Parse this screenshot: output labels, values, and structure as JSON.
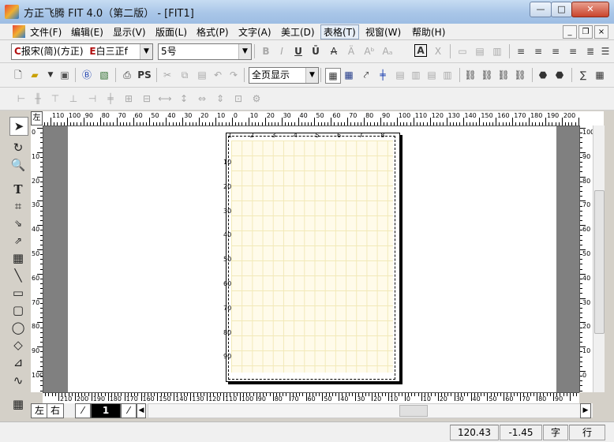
{
  "window": {
    "title": "方正飞腾 FIT 4.0（第二版） - [FIT1]",
    "min": "—",
    "max": "□",
    "close": "✕"
  },
  "menu": [
    {
      "label": "文件(F)"
    },
    {
      "label": "编辑(E)"
    },
    {
      "label": "显示(V)"
    },
    {
      "label": "版面(L)"
    },
    {
      "label": "格式(P)"
    },
    {
      "label": "文字(A)"
    },
    {
      "label": "美工(D)"
    },
    {
      "label": "表格(T)"
    },
    {
      "label": "视窗(W)"
    },
    {
      "label": "帮助(H)"
    }
  ],
  "mdi": {
    "min": "_",
    "restore": "❐",
    "close": "×"
  },
  "format_toolbar": {
    "cn_font_prefix": "C",
    "cn_font": "报宋(简)(方正)",
    "en_font_prefix": "E",
    "en_font": "白三正f",
    "size": "5号",
    "style_buttons": [
      "B",
      "I",
      "U",
      "Ū",
      "A",
      "Ä",
      "Aᵇ",
      "Aₐ",
      "A",
      "Ⅹ"
    ]
  },
  "standard_toolbar": {
    "zoom": "全页显示",
    "ps_label": "PS"
  },
  "rulers": {
    "corner": "左",
    "top": [
      "110",
      "100",
      "90",
      "80",
      "70",
      "60",
      "50",
      "40",
      "30",
      "20",
      "10",
      "0",
      "10",
      "20",
      "30",
      "40",
      "50",
      "60",
      "70",
      "80",
      "90",
      "100",
      "110",
      "120",
      "130",
      "140",
      "150",
      "160",
      "170",
      "180",
      "190",
      "200"
    ],
    "bottom": [
      "210",
      "200",
      "190",
      "180",
      "170",
      "160",
      "150",
      "140",
      "130",
      "120",
      "110",
      "100",
      "90",
      "80",
      "70",
      "60",
      "50",
      "40",
      "30",
      "20",
      "10",
      "0",
      "10",
      "20",
      "30",
      "40",
      "50",
      "60",
      "70",
      "80",
      "90"
    ],
    "left": [
      "0",
      "10",
      "20",
      "30",
      "40",
      "50",
      "60",
      "70",
      "80",
      "90",
      "100"
    ],
    "right": [
      "100",
      "90",
      "80",
      "70",
      "60",
      "50",
      "40",
      "30",
      "20",
      "10",
      "0"
    ],
    "page_left": [
      "10",
      "20",
      "30",
      "40",
      "50",
      "60",
      "70",
      "80",
      "90"
    ],
    "page_top": [
      "1",
      "2",
      "3",
      "4",
      "5",
      "6",
      "7",
      "8"
    ]
  },
  "page_nav": {
    "left": "左",
    "right": "右",
    "current": "1"
  },
  "status": {
    "x": "120.43",
    "y": "-1.45",
    "unit": "字",
    "mode": "行"
  }
}
